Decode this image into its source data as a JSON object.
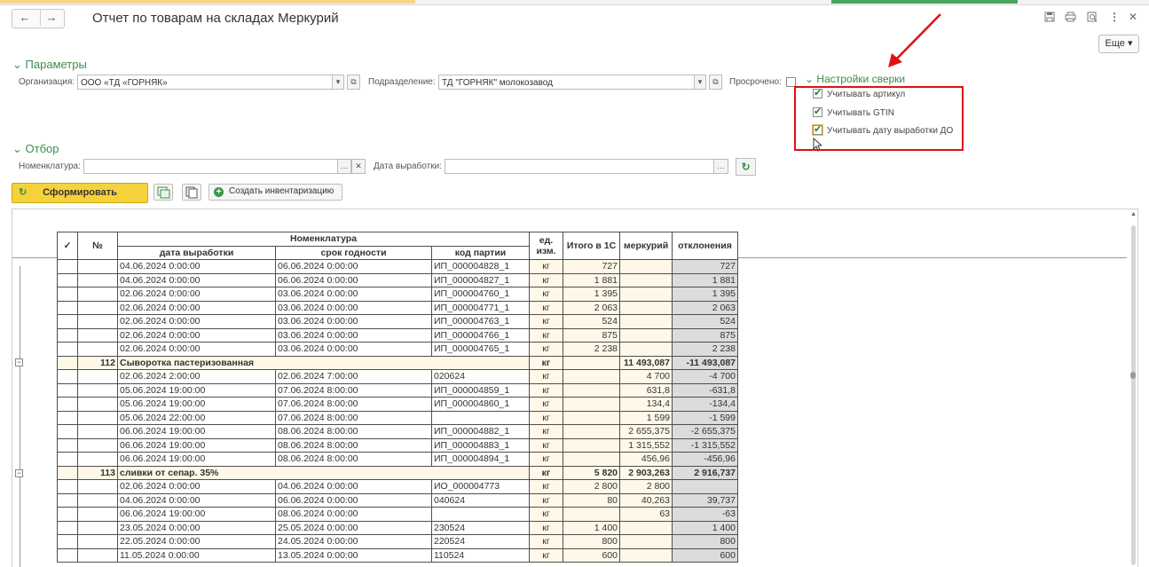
{
  "window": {
    "title": "Отчет по товарам на складах Меркурий",
    "more_label": "Еще",
    "more_arrow": "▾"
  },
  "nav": {
    "back": "←",
    "forward": "→"
  },
  "params": {
    "header": "Параметры",
    "org_label": "Организация:",
    "org_value": "ООО «ТД «ГОРНЯК»",
    "dept_label": "Подразделение:",
    "dept_value": "ТД \"ГОРНЯК\" молокозавод",
    "expired_label": "Просрочено:"
  },
  "recon": {
    "header": "Настройки сверки",
    "options": [
      {
        "label": "Учитывать артикул",
        "checked": true
      },
      {
        "label": "Учитывать GTIN",
        "checked": true
      },
      {
        "label": "Учитывать дату выработки ДО",
        "checked": true
      }
    ]
  },
  "filter": {
    "header": "Отбор",
    "nom_label": "Номенклатура:",
    "nom_value": "",
    "date_label": "Дата выработки:",
    "date_value": ""
  },
  "toolbar": {
    "generate_label": "Сформировать",
    "create_inv_label": "Создать инвентаризацию"
  },
  "table": {
    "headers": {
      "check": "✓",
      "num": "№",
      "nomenclature": "Номенклатура",
      "prod_date": "дата выработки",
      "expiry": "срок годности",
      "batch": "код партии",
      "unit": "ед. изм.",
      "total_1c": "Итого в 1С",
      "mercury": "меркурий",
      "deviation": "отклонения"
    },
    "rows": [
      {
        "type": "item",
        "d1": "04.06.2024 0:00:00",
        "d2": "06.06.2024 0:00:00",
        "batch": "ИП_000004828_1",
        "unit": "кг",
        "q1": "727",
        "q2": "",
        "dev": "727"
      },
      {
        "type": "item",
        "d1": "04.06.2024 0:00:00",
        "d2": "06.06.2024 0:00:00",
        "batch": "ИП_000004827_1",
        "unit": "кг",
        "q1": "1 881",
        "q2": "",
        "dev": "1 881"
      },
      {
        "type": "item",
        "d1": "02.06.2024 0:00:00",
        "d2": "03.06.2024 0:00:00",
        "batch": "ИП_000004760_1",
        "unit": "кг",
        "q1": "1 395",
        "q2": "",
        "dev": "1 395"
      },
      {
        "type": "item",
        "d1": "02.06.2024 0:00:00",
        "d2": "03.06.2024 0:00:00",
        "batch": "ИП_000004771_1",
        "unit": "кг",
        "q1": "2 063",
        "q2": "",
        "dev": "2 063"
      },
      {
        "type": "item",
        "d1": "02.06.2024 0:00:00",
        "d2": "03.06.2024 0:00:00",
        "batch": "ИП_000004763_1",
        "unit": "кг",
        "q1": "524",
        "q2": "",
        "dev": "524"
      },
      {
        "type": "item",
        "d1": "02.06.2024 0:00:00",
        "d2": "03.06.2024 0:00:00",
        "batch": "ИП_000004766_1",
        "unit": "кг",
        "q1": "875",
        "q2": "",
        "dev": "875"
      },
      {
        "type": "item",
        "d1": "02.06.2024 0:00:00",
        "d2": "03.06.2024 0:00:00",
        "batch": "ИП_000004765_1",
        "unit": "кг",
        "q1": "2 238",
        "q2": "",
        "dev": "2 238"
      },
      {
        "type": "group",
        "num": "112",
        "name": "Сыворотка пастеризованная",
        "unit": "кг",
        "q1": "",
        "q2": "11 493,087",
        "dev": "-11 493,087"
      },
      {
        "type": "item",
        "d1": "02.06.2024 2:00:00",
        "d2": "02.06.2024 7:00:00",
        "batch": "020624",
        "unit": "кг",
        "q1": "",
        "q2": "4 700",
        "dev": "-4 700"
      },
      {
        "type": "item",
        "d1": "05.06.2024 19:00:00",
        "d2": "07.06.2024 8:00:00",
        "batch": "ИП_000004859_1",
        "unit": "кг",
        "q1": "",
        "q2": "631,8",
        "dev": "-631,8"
      },
      {
        "type": "item",
        "d1": "05.06.2024 19:00:00",
        "d2": "07.06.2024 8:00:00",
        "batch": "ИП_000004860_1",
        "unit": "кг",
        "q1": "",
        "q2": "134,4",
        "dev": "-134,4"
      },
      {
        "type": "item",
        "d1": "05.06.2024 22:00:00",
        "d2": "07.06.2024 8:00:00",
        "batch": "",
        "unit": "кг",
        "q1": "",
        "q2": "1 599",
        "dev": "-1 599"
      },
      {
        "type": "item",
        "d1": "06.06.2024 19:00:00",
        "d2": "08.06.2024 8:00:00",
        "batch": "ИП_000004882_1",
        "unit": "кг",
        "q1": "",
        "q2": "2 655,375",
        "dev": "-2 655,375"
      },
      {
        "type": "item",
        "d1": "06.06.2024 19:00:00",
        "d2": "08.06.2024 8:00:00",
        "batch": "ИП_000004883_1",
        "unit": "кг",
        "q1": "",
        "q2": "1 315,552",
        "dev": "-1 315,552"
      },
      {
        "type": "item",
        "d1": "06.06.2024 19:00:00",
        "d2": "08.06.2024 8:00:00",
        "batch": "ИП_000004894_1",
        "unit": "кг",
        "q1": "",
        "q2": "456,96",
        "dev": "-456,96"
      },
      {
        "type": "group",
        "num": "113",
        "name": "сливки от сепар. 35%",
        "unit": "кг",
        "q1": "5 820",
        "q2": "2 903,263",
        "dev": "2 916,737"
      },
      {
        "type": "item",
        "d1": "02.06.2024 0:00:00",
        "d2": "04.06.2024 0:00:00",
        "batch": "ИО_000004773",
        "unit": "кг",
        "q1": "2 800",
        "q2": "2 800",
        "dev": ""
      },
      {
        "type": "item",
        "d1": "04.06.2024 0:00:00",
        "d2": "06.06.2024 0:00:00",
        "batch": "040624",
        "unit": "кг",
        "q1": "80",
        "q2": "40,263",
        "dev": "39,737"
      },
      {
        "type": "item",
        "d1": "06.06.2024 19:00:00",
        "d2": "08.06.2024 0:00:00",
        "batch": "",
        "unit": "кг",
        "q1": "",
        "q2": "63",
        "dev": "-63"
      },
      {
        "type": "item",
        "d1": "23.05.2024 0:00:00",
        "d2": "25.05.2024 0:00:00",
        "batch": "230524",
        "unit": "кг",
        "q1": "1 400",
        "q2": "",
        "dev": "1 400"
      },
      {
        "type": "item",
        "d1": "22.05.2024 0:00:00",
        "d2": "24.05.2024 0:00:00",
        "batch": "220524",
        "unit": "кг",
        "q1": "800",
        "q2": "",
        "dev": "800"
      },
      {
        "type": "item",
        "d1": "11.05.2024 0:00:00",
        "d2": "13.05.2024 0:00:00",
        "batch": "110524",
        "unit": "кг",
        "q1": "600",
        "q2": "",
        "dev": "600"
      }
    ]
  }
}
